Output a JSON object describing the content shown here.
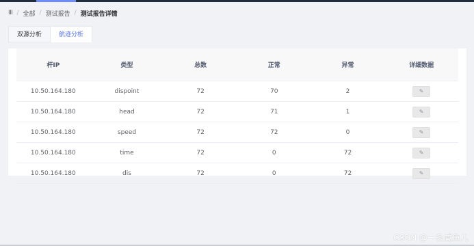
{
  "breadcrumb": {
    "menu_icon": "III",
    "items": [
      "全部",
      "测试报告",
      "测试报告详情"
    ]
  },
  "tabs": [
    "双源分析",
    "航迹分析"
  ],
  "table": {
    "headers": [
      "杆IP",
      "类型",
      "总数",
      "正常",
      "异常",
      "详细数据"
    ],
    "rows": [
      [
        "10.50.164.180",
        "dispoint",
        "72",
        "70",
        "2"
      ],
      [
        "10.50.164.180",
        "head",
        "72",
        "71",
        "1"
      ],
      [
        "10.50.164.180",
        "speed",
        "72",
        "72",
        "0"
      ],
      [
        "10.50.164.180",
        "time",
        "72",
        "0",
        "72"
      ],
      [
        "10.50.164.180",
        "dis",
        "72",
        "0",
        "72"
      ]
    ],
    "detail_icon": "edit-icon"
  },
  "watermark": "CSDN @一条咸鱼儿",
  "colors": {
    "accent": "#4e6ef2",
    "topbar": "#1f2d3d",
    "topbar_accent": "#6c8cff"
  }
}
